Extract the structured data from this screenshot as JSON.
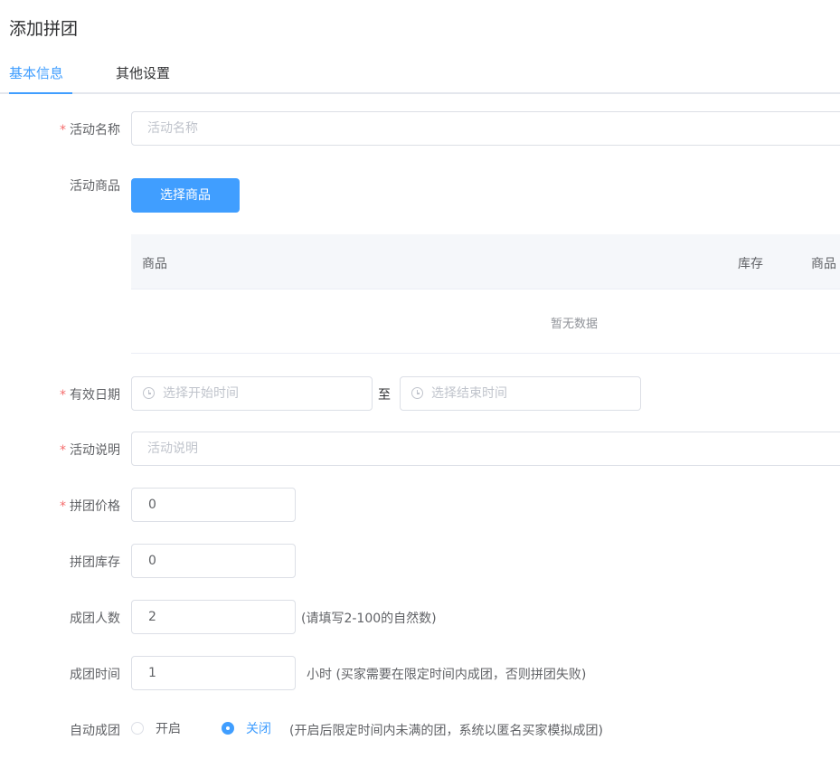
{
  "page": {
    "title": "添加拼团"
  },
  "tabs": [
    {
      "label": "基本信息",
      "active": true
    },
    {
      "label": "其他设置",
      "active": false
    }
  ],
  "form": {
    "activity_name": {
      "label": "活动名称",
      "required": true,
      "placeholder": "活动名称",
      "value": ""
    },
    "activity_goods": {
      "label": "活动商品",
      "button": "选择商品",
      "table": {
        "columns": [
          "商品",
          "库存",
          "商品"
        ],
        "empty_text": "暂无数据"
      }
    },
    "valid_date": {
      "label": "有效日期",
      "required": true,
      "start_placeholder": "选择开始时间",
      "separator": "至",
      "end_placeholder": "选择结束时间"
    },
    "activity_desc": {
      "label": "活动说明",
      "required": true,
      "placeholder": "活动说明",
      "value": ""
    },
    "group_price": {
      "label": "拼团价格",
      "required": true,
      "value": "0"
    },
    "group_stock": {
      "label": "拼团库存",
      "required": false,
      "value": "0"
    },
    "group_size": {
      "label": "成团人数",
      "required": false,
      "value": "2",
      "hint": "(请填写2-100的自然数)"
    },
    "group_time": {
      "label": "成团时间",
      "required": false,
      "value": "1",
      "hint": "小时 (买家需要在限定时间内成团，否则拼团失败)"
    },
    "auto_group": {
      "label": "自动成团",
      "options": [
        {
          "label": "开启",
          "checked": false
        },
        {
          "label": "关闭",
          "checked": true
        }
      ],
      "hint": "(开启后限定时间内未满的团，系统以匿名买家模拟成团)"
    }
  },
  "colors": {
    "primary": "#409eff",
    "required": "#f56c6c",
    "border": "#dcdfe6",
    "placeholder": "#c0c4cc"
  },
  "icons": {
    "date": "clock-icon"
  }
}
